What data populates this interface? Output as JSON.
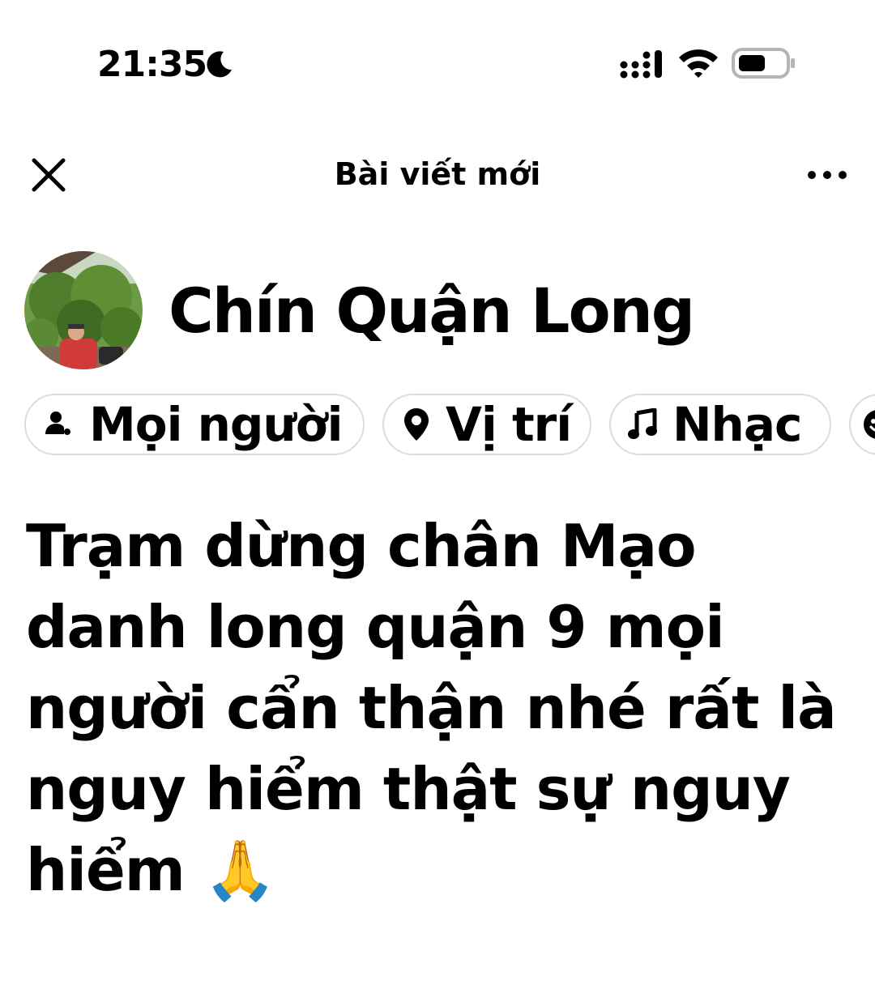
{
  "status_bar": {
    "time": "21:35",
    "icons": [
      "moon-icon",
      "cellular-signal-icon",
      "wifi-icon",
      "battery-icon"
    ]
  },
  "header": {
    "title": "Bài viết mới",
    "close_icon": "close-icon",
    "more_icon": "more-options-icon"
  },
  "author": {
    "name": "Chín Quận Long"
  },
  "chips": [
    {
      "label": "Mọi người",
      "icon": "people-icon"
    },
    {
      "label": "Vị trí",
      "icon": "location-pin-icon"
    },
    {
      "label": "Nhạc",
      "icon": "music-note-icon"
    },
    {
      "label": "",
      "icon": "emoji-icon"
    }
  ],
  "post": {
    "text": "Trạm dừng chân Mạo danh long quận 9 mọi người cẩn thận nhé rất là nguy hiểm thật sự nguy hiểm 🙏"
  },
  "colors": {
    "background": "#ffffff",
    "text": "#000000",
    "chip_border": "#dcdcdc"
  }
}
